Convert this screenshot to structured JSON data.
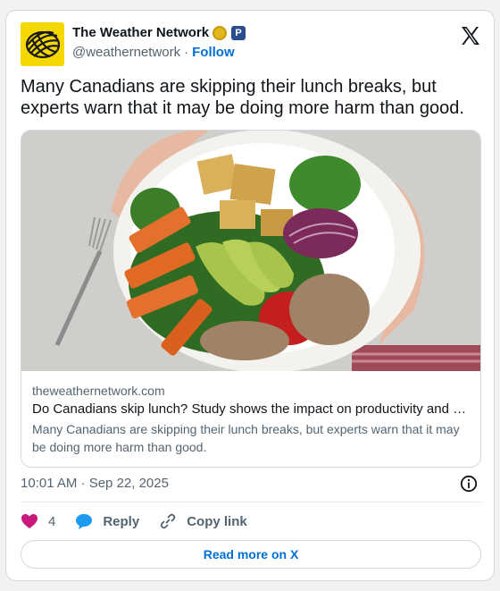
{
  "account": {
    "name": "The Weather Network",
    "handle": "@weathernetwork",
    "separator": "·",
    "follow_label": "Follow",
    "affiliate_badge": "P"
  },
  "tweet": {
    "text": "Many Canadians are skipping their lunch breaks, but experts warn that it may be doing more harm than good.",
    "timestamp": "10:01 AM · Sep 22, 2025"
  },
  "preview": {
    "domain": "theweathernetwork.com",
    "title": "Do Canadians skip lunch? Study shows the impact on productivity and …",
    "description": "Many Canadians are skipping their lunch breaks, but experts warn that it may be doing more harm than good."
  },
  "actions": {
    "like_count": "4",
    "reply_label": "Reply",
    "copy_label": "Copy link"
  },
  "read_more_label": "Read more on X",
  "icons": [
    "weather-network-logo-icon",
    "verified-badge-icon",
    "affiliate-badge-icon",
    "x-logo-icon",
    "info-icon",
    "heart-icon",
    "reply-icon",
    "link-icon"
  ],
  "colors": {
    "link": "#006fd6",
    "like": "#f91880",
    "reply": "#1d9bf0",
    "avatar_bg": "#f5d800"
  }
}
